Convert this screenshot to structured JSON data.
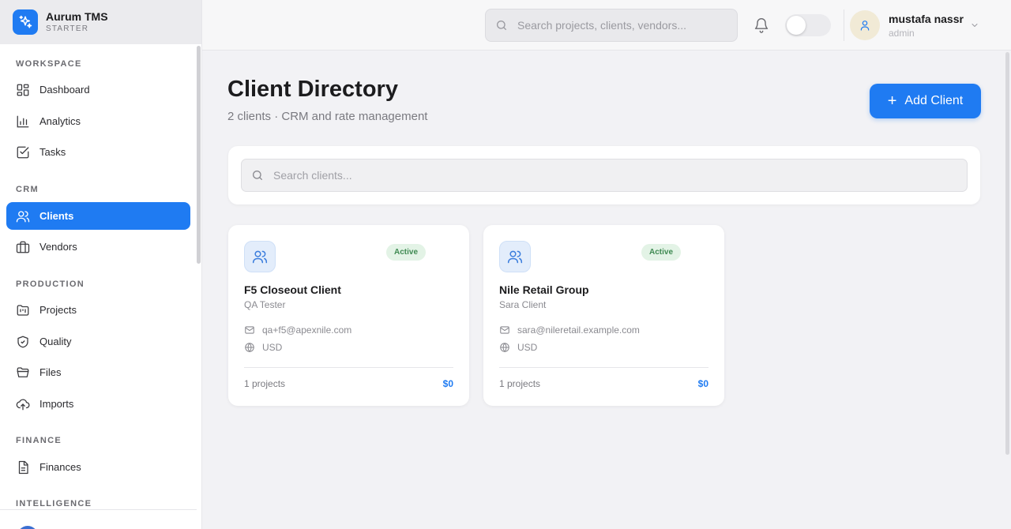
{
  "brand": {
    "name": "Aurum TMS",
    "plan": "STARTER"
  },
  "sidebar": {
    "sections": [
      {
        "label": "WORKSPACE",
        "items": [
          {
            "label": "Dashboard",
            "icon": "grid-icon"
          },
          {
            "label": "Analytics",
            "icon": "bar-chart-icon"
          },
          {
            "label": "Tasks",
            "icon": "checkbox-icon"
          }
        ]
      },
      {
        "label": "CRM",
        "items": [
          {
            "label": "Clients",
            "icon": "users-icon",
            "active": true
          },
          {
            "label": "Vendors",
            "icon": "briefcase-icon"
          }
        ]
      },
      {
        "label": "PRODUCTION",
        "items": [
          {
            "label": "Projects",
            "icon": "folder-kanban-icon"
          },
          {
            "label": "Quality",
            "icon": "shield-icon"
          },
          {
            "label": "Files",
            "icon": "folder-icon"
          },
          {
            "label": "Imports",
            "icon": "upload-cloud-icon"
          }
        ]
      },
      {
        "label": "FINANCE",
        "items": [
          {
            "label": "Finances",
            "icon": "document-icon"
          }
        ]
      },
      {
        "label": "INTELLIGENCE",
        "items": []
      }
    ]
  },
  "topbar": {
    "search_placeholder": "Search projects, clients, vendors...",
    "user": {
      "name": "mustafa nassr",
      "role": "admin"
    }
  },
  "main": {
    "title": "Client Directory",
    "subtitle": "2 clients · CRM and rate management",
    "add_label": "Add Client",
    "search_placeholder": "Search clients..."
  },
  "clients": [
    {
      "name": "F5 Closeout Client",
      "contact": "QA Tester",
      "email": "qa+f5@apexnile.com",
      "currency": "USD",
      "status": "Active",
      "projects": "1 projects",
      "amount": "$0"
    },
    {
      "name": "Nile Retail Group",
      "contact": "Sara Client",
      "email": "sara@nileretail.example.com",
      "currency": "USD",
      "status": "Active",
      "projects": "1 projects",
      "amount": "$0"
    }
  ],
  "colors": {
    "accent": "#1f7bf2",
    "active_badge_bg": "#e3f3e6",
    "active_badge_text": "#3f8a52"
  }
}
